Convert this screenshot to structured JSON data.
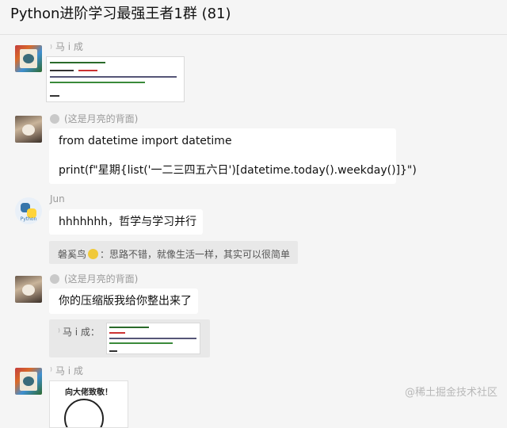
{
  "header": {
    "title": "Python进阶学习最强王者1群 (81)"
  },
  "messages": [
    {
      "sender": "马 i 成",
      "type": "image"
    },
    {
      "sender": "(这是月亮的背面)",
      "lines": [
        "from datetime import datetime",
        "print(f\"星期{list('一二三四五六日')[datetime.today().weekday()]}\")"
      ]
    },
    {
      "sender": "Jun",
      "text": "hhhhhhh，哲学与学习并行",
      "quote": {
        "author": "磐奚鸟",
        "text": "：思路不错，就像生活一样，其实可以很简单"
      }
    },
    {
      "sender": "(这是月亮的背面)",
      "text": "你的压缩版我给你整出来了",
      "quote": {
        "author": "马 i 成："
      }
    },
    {
      "sender": "马 i 成",
      "type": "image",
      "caption": "向大佬致敬！"
    }
  ],
  "avatars": {
    "python_label": "Python"
  },
  "watermark": "@稀土掘金技术社区"
}
